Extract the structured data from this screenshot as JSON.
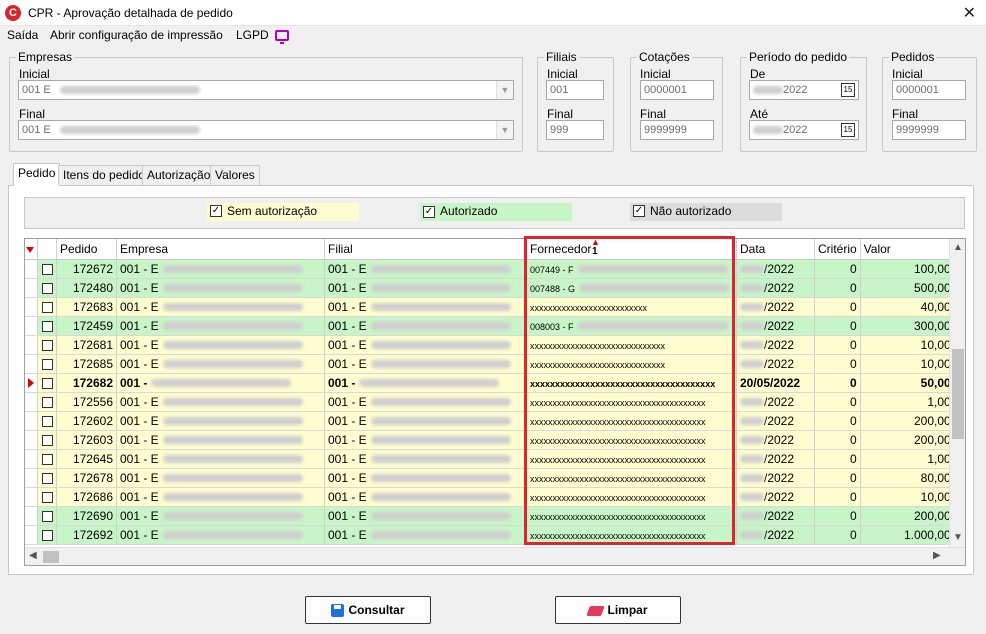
{
  "window": {
    "title": "CPR - Aprovação detalhada de pedido",
    "close_icon": "close-icon"
  },
  "menu": {
    "saida": "Saída",
    "abrir": "Abrir configuração de impressão",
    "lgpd": "LGPD"
  },
  "empresas": {
    "legend": "Empresas",
    "inicial_label": "Inicial",
    "inicial_value": "001 E",
    "final_label": "Final",
    "final_value": "001 E"
  },
  "filiais": {
    "legend": "Filiais",
    "inicial_label": "Inicial",
    "inicial_value": "001",
    "final_label": "Final",
    "final_value": "999"
  },
  "cotacoes": {
    "legend": "Cotações",
    "inicial_label": "Inicial",
    "inicial_value": "0000001",
    "final_label": "Final",
    "final_value": "9999999"
  },
  "periodo": {
    "legend": "Período do pedido",
    "de_label": "De",
    "de_value": "2022",
    "ate_label": "Até",
    "ate_value": "2022",
    "calendar_glyph": "15"
  },
  "pedidos": {
    "legend": "Pedidos",
    "inicial_label": "Inicial",
    "inicial_value": "0000001",
    "final_label": "Final",
    "final_value": "9999999"
  },
  "tabs": [
    "Pedido",
    "Itens do pedido",
    "Autorização",
    "Valores"
  ],
  "filters": {
    "sem": "Sem autorização",
    "autorizado": "Autorizado",
    "nao": "Não autorizado",
    "colors": {
      "sem": "#fefdd0",
      "autorizado": "#c8f5c8",
      "nao": "#dcdcdc"
    }
  },
  "grid": {
    "headers": {
      "pedido": "Pedido",
      "empresa": "Empresa",
      "filial": "Filial",
      "fornecedor": "Fornecedor",
      "sort_index": "1",
      "data": "Data",
      "criterio": "Critério",
      "valor": "Valor"
    },
    "rows": [
      {
        "pedido": "172672",
        "empresa": "001 - E",
        "filial": "001 - E",
        "fornecedor": "007449 - F",
        "data": "/2022",
        "criterio": "0",
        "valor": "100,00",
        "status": "green"
      },
      {
        "pedido": "172480",
        "empresa": "001 - E",
        "filial": "001 - E",
        "fornecedor": "007488 - G",
        "data": "/2022",
        "criterio": "0",
        "valor": "500,00",
        "status": "green"
      },
      {
        "pedido": "172683",
        "empresa": "001 - E",
        "filial": "001 - E",
        "fornecedor": "xxxxxxxxxxxxxxxxxxxxxxxxxx",
        "data": "/2022",
        "criterio": "0",
        "valor": "40,00",
        "status": "yellow"
      },
      {
        "pedido": "172459",
        "empresa": "001 - E",
        "filial": "001 - E",
        "fornecedor": "008003 - F",
        "data": "/2022",
        "criterio": "0",
        "valor": "300,00",
        "status": "green"
      },
      {
        "pedido": "172681",
        "empresa": "001 - E",
        "filial": "001 - E",
        "fornecedor": "xxxxxxxxxxxxxxxxxxxxxxxxxxxxxx",
        "data": "/2022",
        "criterio": "0",
        "valor": "10,00",
        "status": "yellow"
      },
      {
        "pedido": "172685",
        "empresa": "001 - E",
        "filial": "001 - E",
        "fornecedor": "xxxxxxxxxxxxxxxxxxxxxxxxxxxxxx",
        "data": "/2022",
        "criterio": "0",
        "valor": "10,00",
        "status": "yellow"
      },
      {
        "pedido": "172682",
        "empresa": "001 -",
        "filial": "001 -",
        "fornecedor": "xxxxxxxxxxxxxxxxxxxxxxxxxxxxxxxxxxxxx",
        "data": "20/05/2022",
        "criterio": "0",
        "valor": "50,00",
        "status": "yellow",
        "current": true
      },
      {
        "pedido": "172556",
        "empresa": "001 - E",
        "filial": "001 - E",
        "fornecedor": "xxxxxxxxxxxxxxxxxxxxxxxxxxxxxxxxxxxxxxx",
        "data": "/2022",
        "criterio": "0",
        "valor": "1,00",
        "status": "yellow"
      },
      {
        "pedido": "172602",
        "empresa": "001 - E",
        "filial": "001 - E",
        "fornecedor": "xxxxxxxxxxxxxxxxxxxxxxxxxxxxxxxxxxxxxxx",
        "data": "/2022",
        "criterio": "0",
        "valor": "200,00",
        "status": "yellow"
      },
      {
        "pedido": "172603",
        "empresa": "001 - E",
        "filial": "001 - E",
        "fornecedor": "xxxxxxxxxxxxxxxxxxxxxxxxxxxxxxxxxxxxxxx",
        "data": "/2022",
        "criterio": "0",
        "valor": "200,00",
        "status": "yellow"
      },
      {
        "pedido": "172645",
        "empresa": "001 - E",
        "filial": "001 - E",
        "fornecedor": "xxxxxxxxxxxxxxxxxxxxxxxxxxxxxxxxxxxxxxx",
        "data": "/2022",
        "criterio": "0",
        "valor": "1,00",
        "status": "yellow"
      },
      {
        "pedido": "172678",
        "empresa": "001 - E",
        "filial": "001 - E",
        "fornecedor": "xxxxxxxxxxxxxxxxxxxxxxxxxxxxxxxxxxxxxxx",
        "data": "/2022",
        "criterio": "0",
        "valor": "80,00",
        "status": "yellow"
      },
      {
        "pedido": "172686",
        "empresa": "001 - E",
        "filial": "001 - E",
        "fornecedor": "xxxxxxxxxxxxxxxxxxxxxxxxxxxxxxxxxxxxxxx",
        "data": "/2022",
        "criterio": "0",
        "valor": "10,00",
        "status": "yellow"
      },
      {
        "pedido": "172690",
        "empresa": "001 - E",
        "filial": "001 - E",
        "fornecedor": "xxxxxxxxxxxxxxxxxxxxxxxxxxxxxxxxxxxxxxx",
        "data": "/2022",
        "criterio": "0",
        "valor": "200,00",
        "status": "green"
      },
      {
        "pedido": "172692",
        "empresa": "001 - E",
        "filial": "001 - E",
        "fornecedor": "xxxxxxxxxxxxxxxxxxxxxxxxxxxxxxxxxxxxxxx",
        "data": "/2022",
        "criterio": "0",
        "valor": "1.000,00",
        "status": "green"
      }
    ]
  },
  "buttons": {
    "consultar": "Consultar",
    "limpar": "Limpar"
  },
  "colors": {
    "highlight": "#e0242c",
    "green_row": "#c8f5c8",
    "yellow_row": "#fefdd0"
  }
}
